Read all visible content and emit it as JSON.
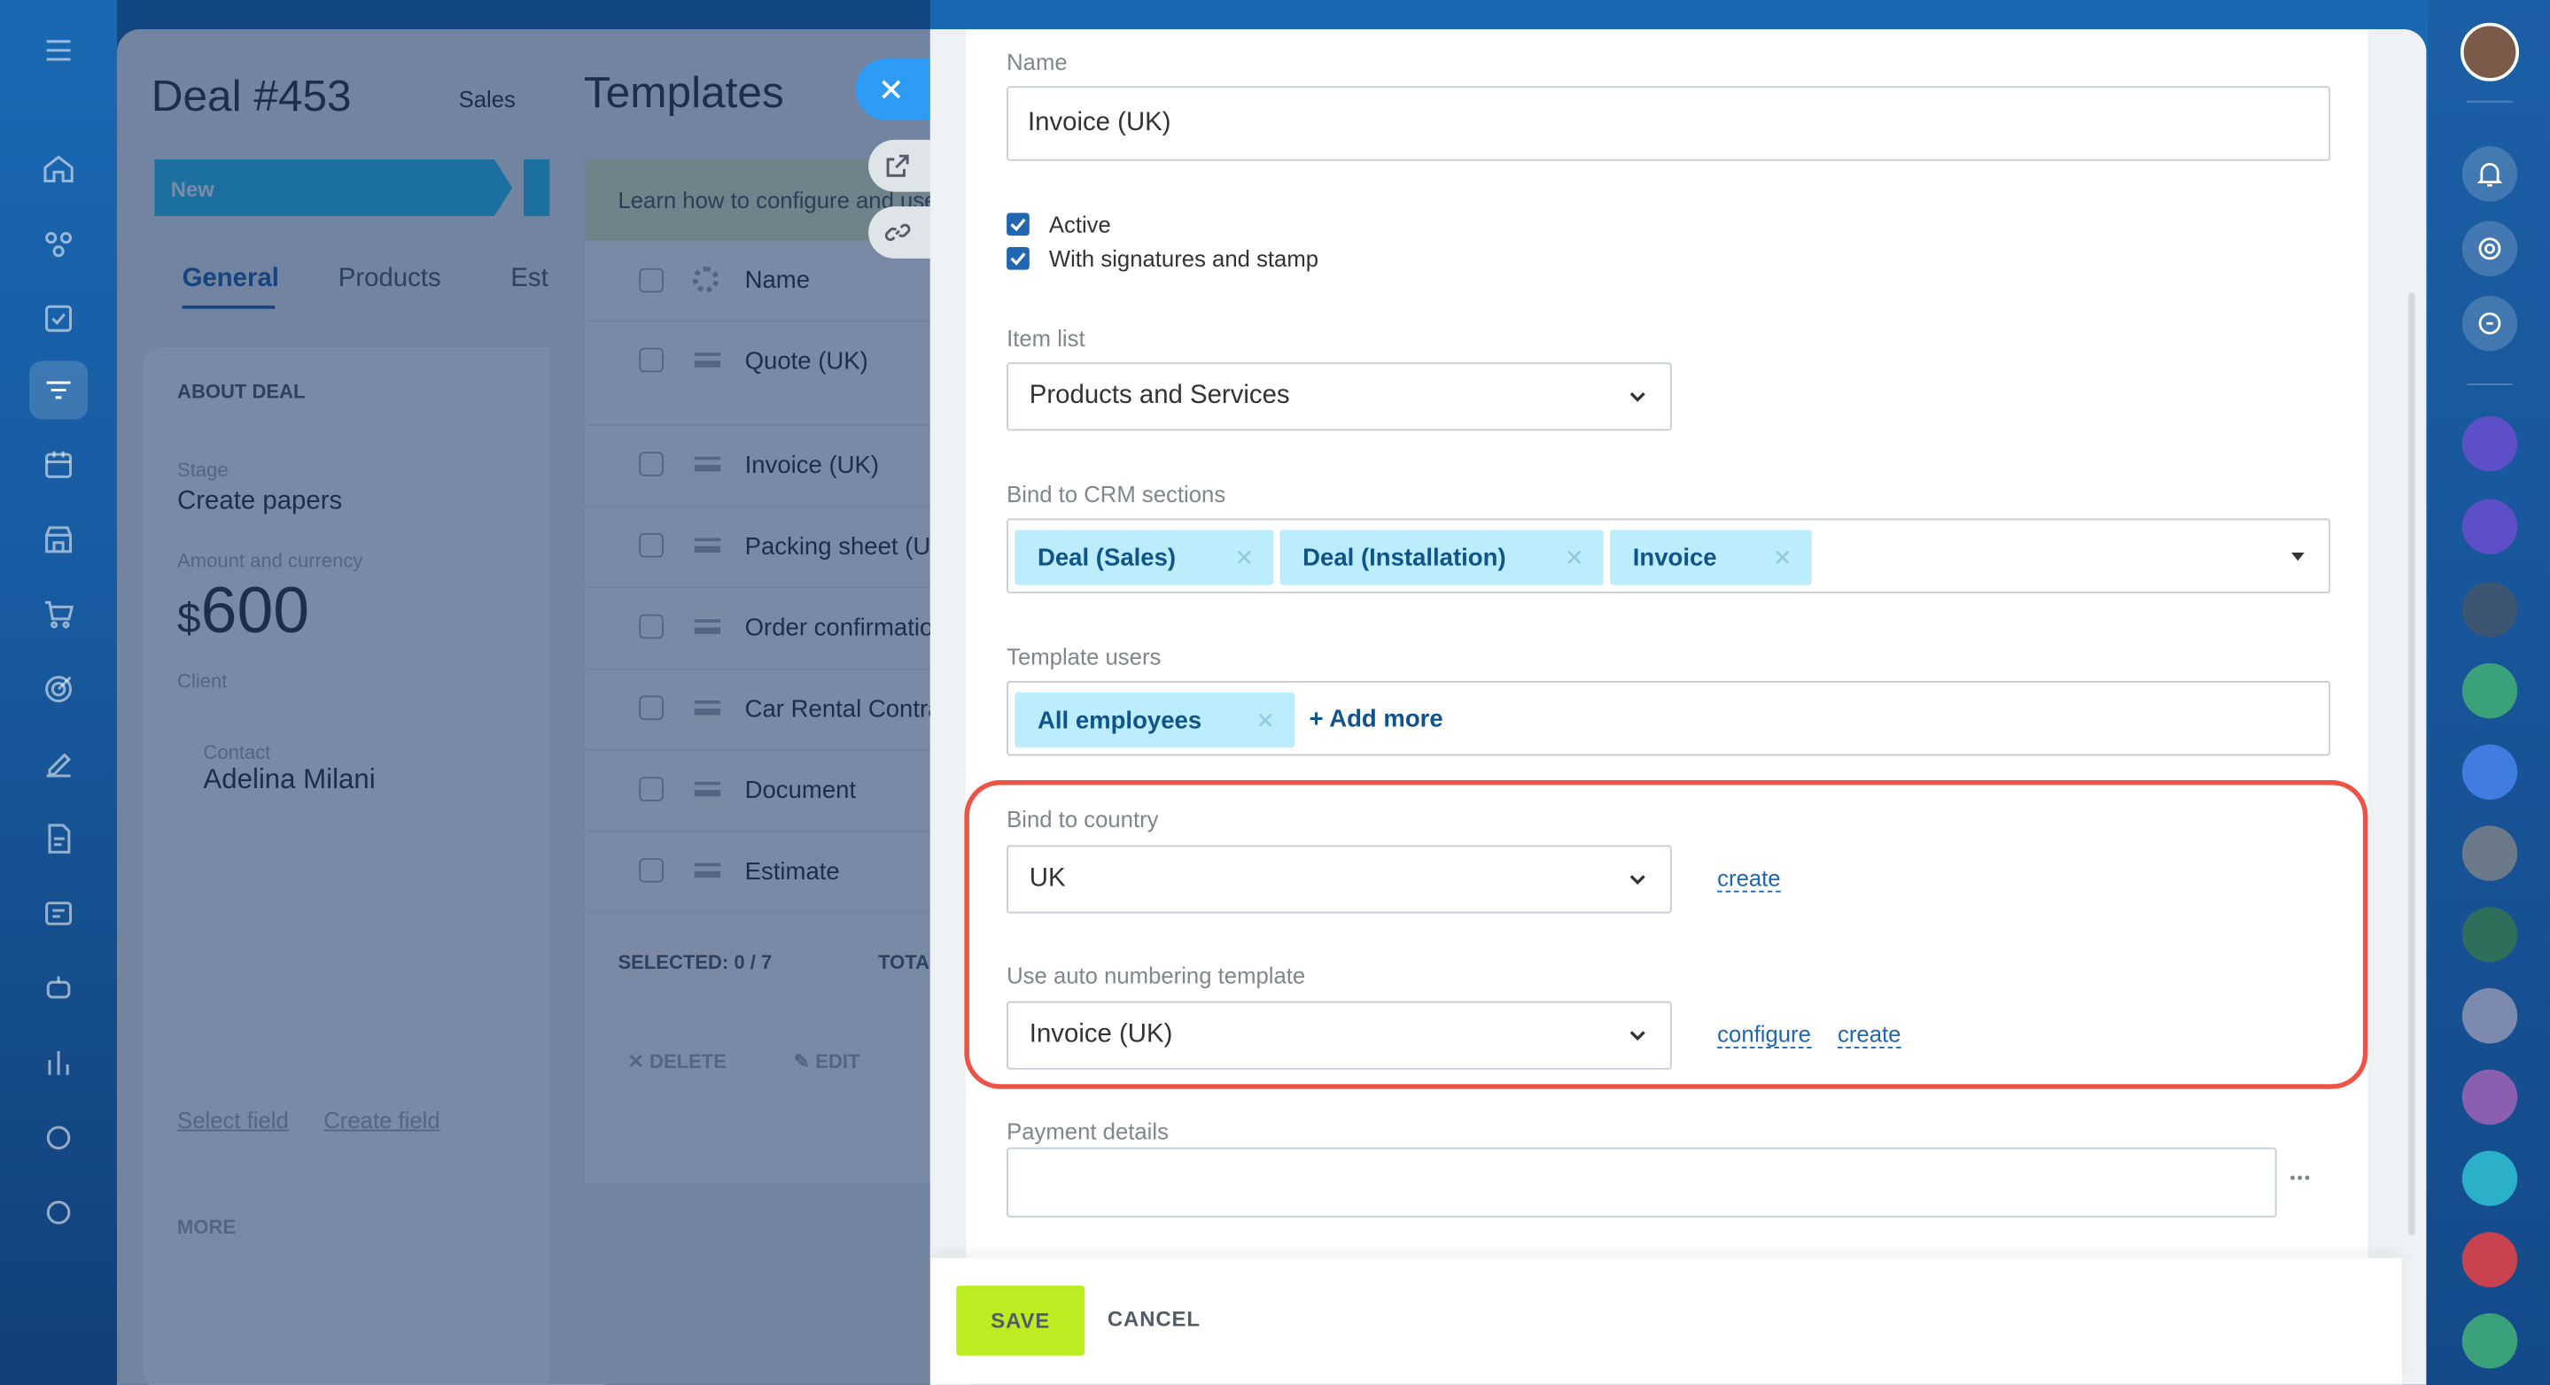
{
  "left_rail": {
    "icons": [
      "menu-icon",
      "home-icon",
      "crm-icon",
      "tasks-icon",
      "filter-icon",
      "calendar-icon",
      "store-icon",
      "cart-icon",
      "target-icon",
      "sign-icon",
      "docs-icon",
      "inbox-icon",
      "robot-icon",
      "analytics-icon",
      "settings-icon",
      "help-icon"
    ]
  },
  "deal": {
    "title": "Deal #453",
    "pipeline": "Sales",
    "stage_label": "New",
    "tabs": [
      "General",
      "Products",
      "Est"
    ],
    "section": "ABOUT DEAL",
    "stage_caption": "Stage",
    "stage_value": "Create papers",
    "amount_caption": "Amount and currency",
    "currency": "$",
    "amount": "600",
    "client_caption": "Client",
    "contact_caption": "Contact",
    "contact_name": "Adelina Milani",
    "select_field": "Select field",
    "create_field": "Create field",
    "more": "MORE"
  },
  "templates": {
    "title": "Templates",
    "hint": "Learn how to configure and use",
    "column_name": "Name",
    "rows": [
      "Quote (UK)",
      "Invoice (UK)",
      "Packing sheet (UK)",
      "Order confirmation",
      "Car Rental Contract",
      "Document",
      "Estimate"
    ],
    "selected": "SELECTED: 0 / 7",
    "total": "TOTAL",
    "delete": "DELETE",
    "edit": "EDIT"
  },
  "form": {
    "name_label": "Name",
    "name_value": "Invoice (UK)",
    "active_label": "Active",
    "signatures_label": "With signatures and stamp",
    "item_list_label": "Item list",
    "item_list_value": "Products and Services",
    "bind_crm_label": "Bind to CRM sections",
    "crm_tags": [
      "Deal (Sales)",
      "Deal (Installation)",
      "Invoice"
    ],
    "template_users_label": "Template users",
    "user_tag": "All employees",
    "add_more": "+ Add more",
    "bind_country_label": "Bind to country",
    "country_value": "UK",
    "country_create": "create",
    "auto_numbering_label": "Use auto numbering template",
    "numbering_value": "Invoice (UK)",
    "numbering_configure": "configure",
    "numbering_create": "create",
    "payment_details_label": "Payment details",
    "payment_details_value": "",
    "more_dots": "•••"
  },
  "footer": {
    "save": "SAVE",
    "cancel": "CANCEL"
  },
  "colors": {
    "accent": "#2066b0",
    "save": "#bbed21",
    "tag_bg": "#bcedfc",
    "highlight": "#ef5346"
  }
}
